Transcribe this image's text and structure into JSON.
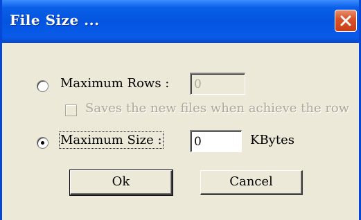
{
  "window": {
    "title": "File Size ..."
  },
  "options": {
    "max_rows": {
      "label": "Maximum Rows :",
      "value": "0",
      "selected": false,
      "enabled": false
    },
    "save_new_files": {
      "label": "Saves the new files when achieve the row",
      "checked": false,
      "enabled": false
    },
    "max_size": {
      "label": "Maximum Size :",
      "value": "0",
      "unit": "KBytes",
      "selected": true,
      "enabled": true
    }
  },
  "buttons": {
    "ok": "Ok",
    "cancel": "Cancel"
  },
  "icons": {
    "close": "close-icon"
  },
  "colors": {
    "titlebar": "#0454e0",
    "close_button": "#d9542a",
    "dialog_bg": "#ece9d8",
    "disabled_text": "#aca899"
  }
}
